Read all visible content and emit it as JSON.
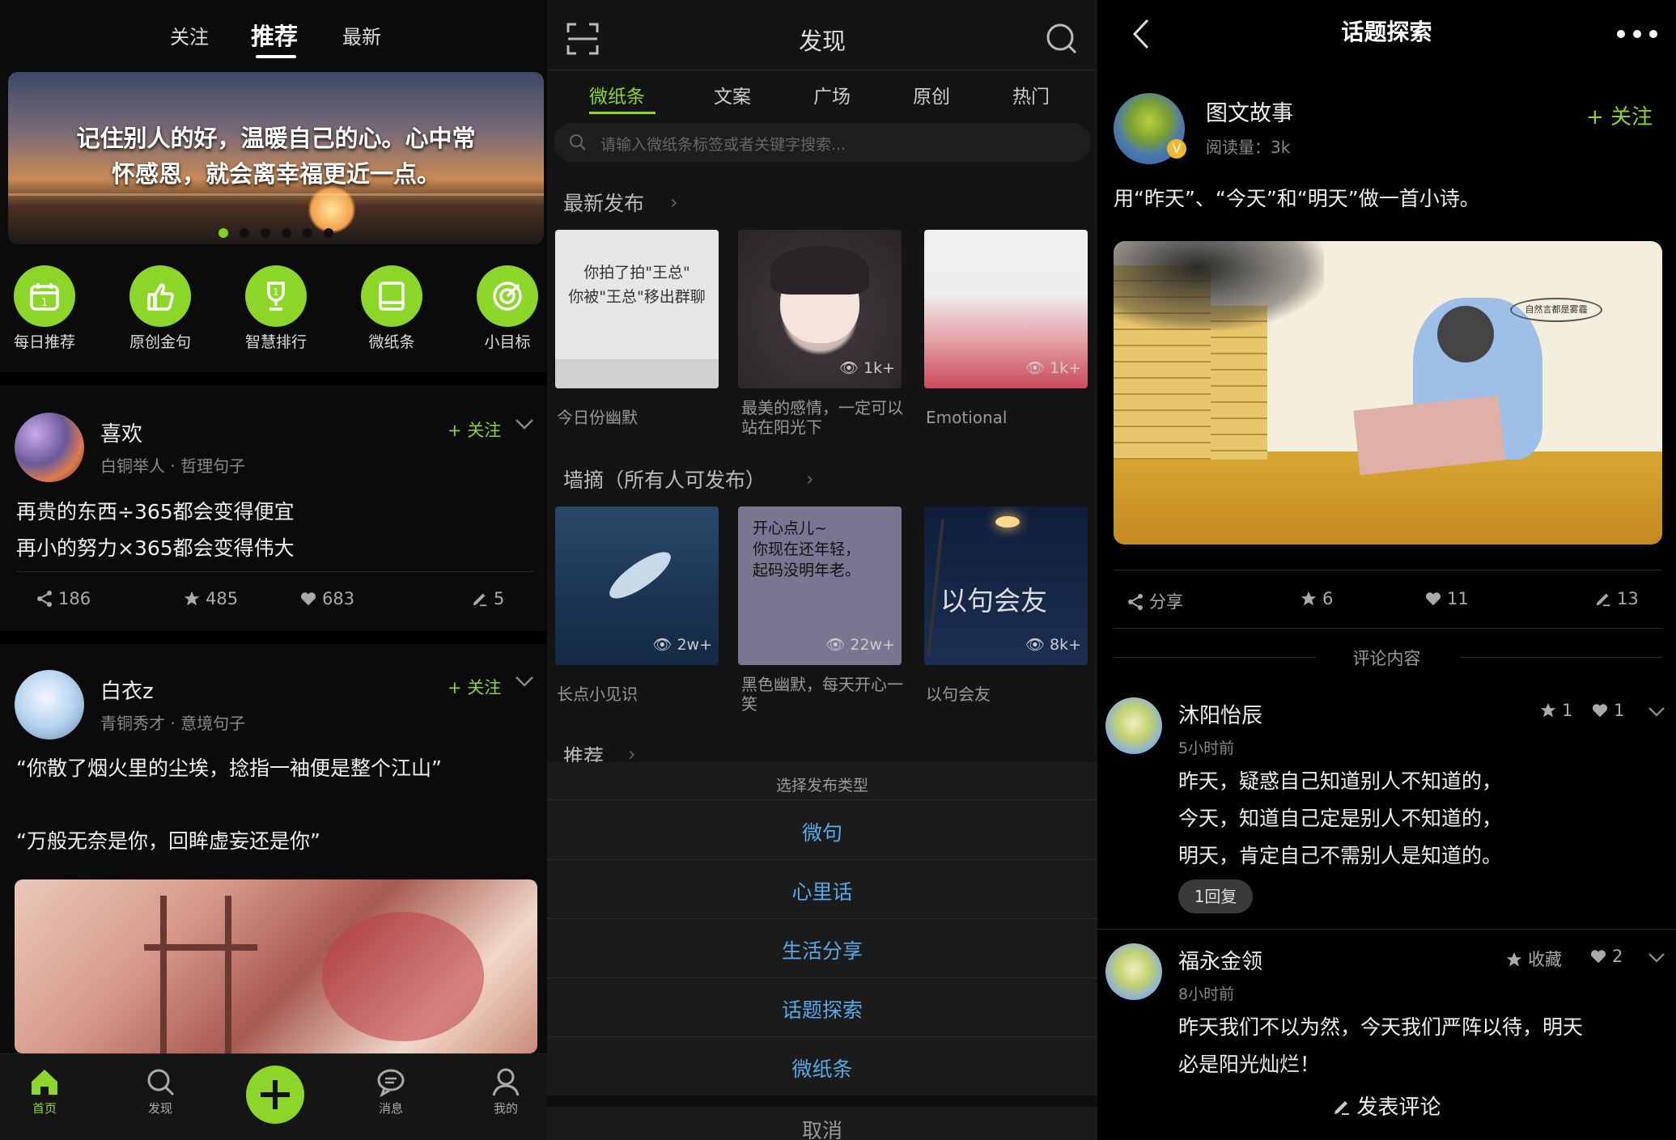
{
  "home": {
    "top_tabs": [
      "关注",
      "推荐",
      "最新"
    ],
    "active_tab": "推荐",
    "banner_text": "记住别人的好，温暖自己的心。心中常怀感恩，就会离幸福更近一点。",
    "banner_page_count": 6,
    "quick_links": [
      {
        "label": "每日推荐",
        "icon": "calendar-icon"
      },
      {
        "label": "原创金句",
        "icon": "thumbs-up-icon"
      },
      {
        "label": "智慧排行",
        "icon": "trophy-icon"
      },
      {
        "label": "微纸条",
        "icon": "note-icon"
      },
      {
        "label": "小目标",
        "icon": "target-icon"
      }
    ],
    "posts": [
      {
        "user": "喜欢",
        "meta": "白铜举人 · 哲理句子",
        "follow": "+ 关注",
        "lines": [
          "再贵的东西÷365都会变得便宜",
          "再小的努力×365都会变得伟大"
        ],
        "shares": "186",
        "stars": "485",
        "likes": "683",
        "edits": "5"
      },
      {
        "user": "白衣z",
        "meta": "青铜秀才 · 意境句子",
        "follow": "+ 关注",
        "lines": [
          "“你散了烟火里的尘埃，捻指一袖便是整个江山”",
          "“万般无奈是你，回眸虚妄还是你”"
        ]
      }
    ],
    "bottom_tabs": [
      "首页",
      "发现",
      "消息",
      "我的"
    ],
    "active_bottom_tab": "首页"
  },
  "discover": {
    "title": "发现",
    "tabs": [
      "微纸条",
      "文案",
      "广场",
      "原创",
      "热门"
    ],
    "active_tab": "微纸条",
    "search_placeholder": "请输入微纸条标签或者关键字搜索...",
    "section_latest": "最新发布",
    "latest_cards": [
      {
        "text": "你拍了拍\"王总\"\n你被\"王总\"移出群聊",
        "caption": "今日份幽默",
        "views": ""
      },
      {
        "text": "",
        "caption": "最美的感情，一定可以站在阳光下",
        "views": "1k+"
      },
      {
        "text": "",
        "caption": "Emotional",
        "views": "1k+"
      }
    ],
    "section_wall": "墙摘（所有人可发布）",
    "wall_cards": [
      {
        "text": "",
        "caption": "长点小见识",
        "views": "2w+"
      },
      {
        "text": "开心点儿~\n你现在还年轻，\n起码没明年老。",
        "caption": "黑色幽默，每天开心一笑",
        "views": "22w+"
      },
      {
        "text": "以句会友",
        "caption": "以句会友",
        "views": "8k+"
      }
    ],
    "section_recommend": "推荐",
    "sheet_title": "选择发布类型",
    "sheet_options": [
      "微句",
      "心里话",
      "生活分享",
      "话题探索",
      "微纸条"
    ],
    "sheet_cancel": "取消"
  },
  "topic": {
    "title": "话题探索",
    "author": "图文故事",
    "reads": "阅读量：3k",
    "follow": "+ 关注",
    "prompt": "用“昨天”、“今天”和“明天”做一首小诗。",
    "image_note": "自然言都是雾霾",
    "share_label": "分享",
    "stars": "6",
    "likes": "11",
    "edits": "13",
    "comments_header": "评论内容",
    "comments": [
      {
        "name": "沐阳怡辰",
        "time": "5小时前",
        "stars": "1",
        "likes": "1",
        "lines": [
          "昨天，疑惑自己知道别人不知道的，",
          "今天，知道自己定是别人不知道的，",
          "明天，肯定自己不需别人是知道的。"
        ],
        "reply_badge": "1回复"
      },
      {
        "name": "福永金领",
        "time": "8小时前",
        "star_label": "收藏",
        "likes": "2",
        "lines": [
          "昨天我们不以为然，今天我们严阵以待，明天",
          "必是阳光灿烂！"
        ]
      }
    ],
    "post_comment": "发表评论"
  },
  "colors": {
    "accent_green": "#8cd62a",
    "link_blue": "#5aa8e6"
  }
}
